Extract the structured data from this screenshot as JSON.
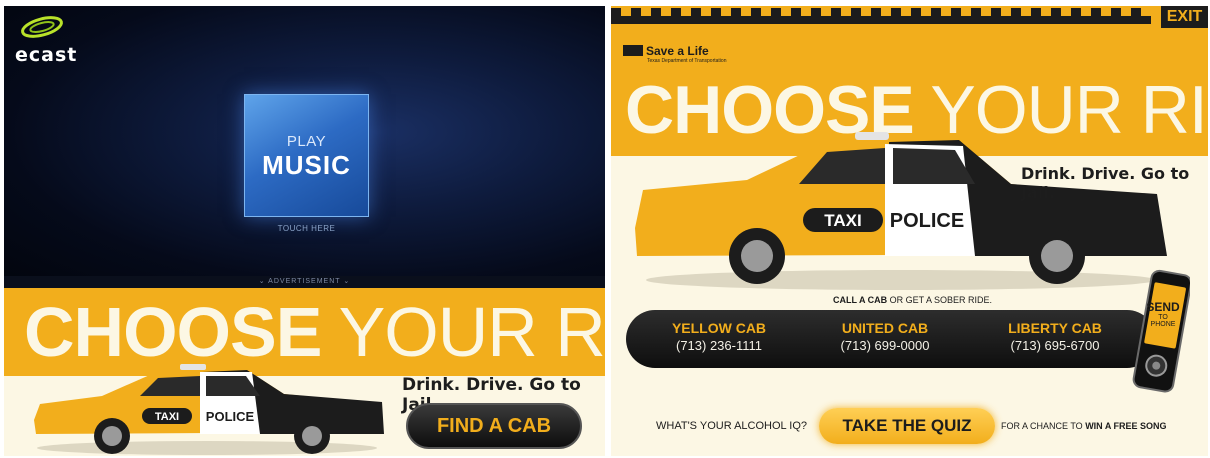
{
  "colors": {
    "brand_yellow": "#f2ae1c",
    "cream": "#fcf7e4",
    "dark": "#1c1c1c",
    "night_blue": "#0e1b3d"
  },
  "left_panel": {
    "logo": {
      "text": "ecast",
      "icon": "ecast-swoosh-icon"
    },
    "play": {
      "small": "PLAY",
      "big": "MUSIC"
    },
    "touch_label": "TOUCH HERE",
    "ad_label": "ADVERTISEMENT",
    "headline": {
      "bold": "CHOOSE",
      "light": " YOUR RIDE."
    },
    "tagline": "Drink. Drive. Go to Jail.",
    "car": {
      "taxi_label": "TAXI",
      "police_label": "POLICE"
    },
    "find_cab_button": "FIND A CAB"
  },
  "right_panel": {
    "exit_button": "EXIT",
    "save_a_life": {
      "title": "Save a Life",
      "subtitle": "Texas Department of Transportation"
    },
    "headline": {
      "bold": "CHOOSE",
      "light": " YOUR RIDE."
    },
    "tagline": "Drink. Drive. Go to Jail.",
    "car": {
      "taxi_label": "TAXI",
      "police_label": "POLICE"
    },
    "call_line": {
      "bold": "CALL A CAB",
      "rest": " OR GET A SOBER RIDE."
    },
    "cabs": [
      {
        "name": "YELLOW CAB",
        "phone": "(713) 236-1111"
      },
      {
        "name": "UNITED CAB",
        "phone": "(713) 699-0000"
      },
      {
        "name": "LIBERTY CAB",
        "phone": "(713) 695-6700"
      }
    ],
    "send": {
      "big": "SEND",
      "small": "TO PHONE"
    },
    "quiz": {
      "question": "WHAT'S YOUR ALCOHOL IQ?",
      "button": "TAKE THE QUIZ",
      "chance_prefix": "FOR A CHANCE TO ",
      "chance_bold": "WIN A FREE SONG"
    }
  }
}
